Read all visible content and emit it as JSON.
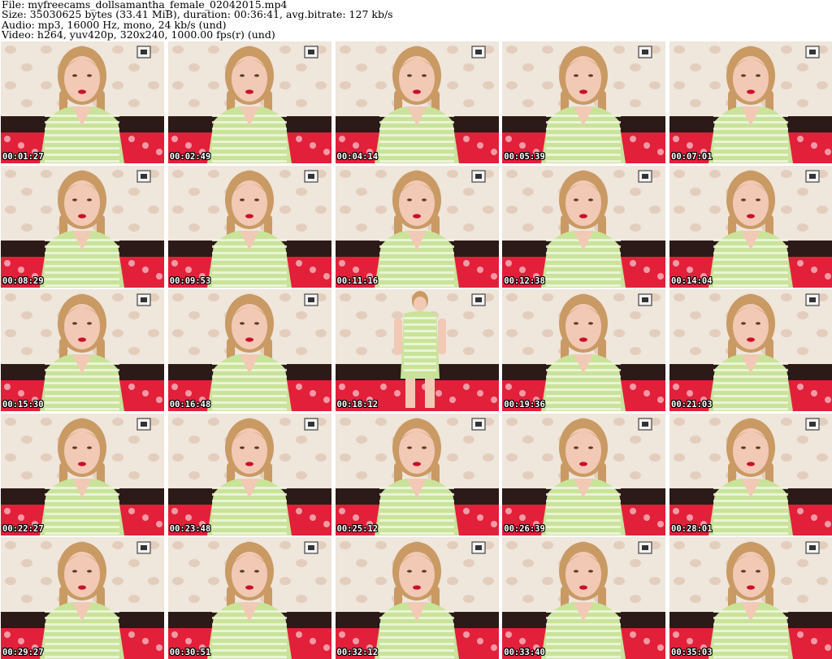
{
  "header": {
    "file_line": "File: myfreecams_dollsamantha_female_02042015.mp4",
    "size_line": "Size: 35030625 bytes (33.41 MiB), duration: 00:36:41, avg.bitrate: 127 kb/s",
    "audio_line": "Audio: mp3, 16000 Hz, mono, 24 kb/s (und)",
    "video_line": "Video: h264, yuv420p, 320x240, 1000.00 fps(r) (und)"
  },
  "colors": {
    "wall": "#efe6dc",
    "wall_pattern": "#d9b9a4",
    "headboard": "#2b1a17",
    "bedspread": "#e2203a",
    "shirt": "#c9e39a",
    "shirt_stripe": "#f2f7e4",
    "skin": "#f2c9b5",
    "hair": "#c99a63",
    "lips": "#c8102e",
    "timestamp_text": "#ffffff",
    "timestamp_outline": "#000000"
  },
  "thumbnails": [
    {
      "timestamp": "00:01:27"
    },
    {
      "timestamp": "00:02:49"
    },
    {
      "timestamp": "00:04:14"
    },
    {
      "timestamp": "00:05:39"
    },
    {
      "timestamp": "00:07:01"
    },
    {
      "timestamp": "00:08:29"
    },
    {
      "timestamp": "00:09:53"
    },
    {
      "timestamp": "00:11:16"
    },
    {
      "timestamp": "00:12:38"
    },
    {
      "timestamp": "00:14:04"
    },
    {
      "timestamp": "00:15:30"
    },
    {
      "timestamp": "00:16:48"
    },
    {
      "timestamp": "00:18:12"
    },
    {
      "timestamp": "00:19:36"
    },
    {
      "timestamp": "00:21:03"
    },
    {
      "timestamp": "00:22:27"
    },
    {
      "timestamp": "00:23:48"
    },
    {
      "timestamp": "00:25:12"
    },
    {
      "timestamp": "00:26:39"
    },
    {
      "timestamp": "00:28:01"
    },
    {
      "timestamp": "00:29:27"
    },
    {
      "timestamp": "00:30:51"
    },
    {
      "timestamp": "00:32:12"
    },
    {
      "timestamp": "00:33:40"
    },
    {
      "timestamp": "00:35:03"
    }
  ]
}
